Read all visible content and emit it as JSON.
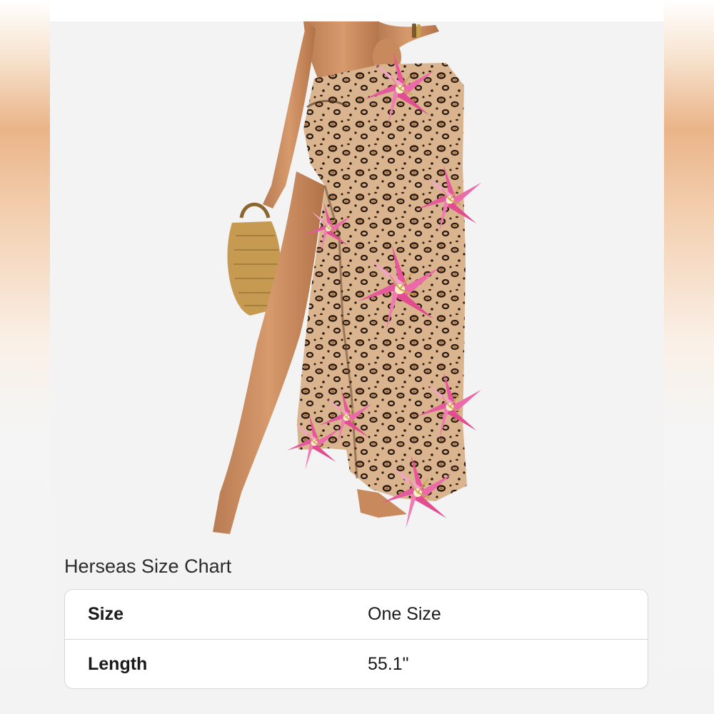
{
  "product_image": {
    "alt": "Leopard print sarong wrap skirt with pink lily flowers"
  },
  "size_chart": {
    "title": "Herseas Size Chart",
    "rows": [
      {
        "label": "Size",
        "value": "One Size"
      },
      {
        "label": "Length",
        "value": "55.1\""
      }
    ]
  },
  "colors": {
    "page_bg": "#f3f3f3",
    "accent_gradient": "#eab488",
    "table_border": "#d7d7d7"
  }
}
